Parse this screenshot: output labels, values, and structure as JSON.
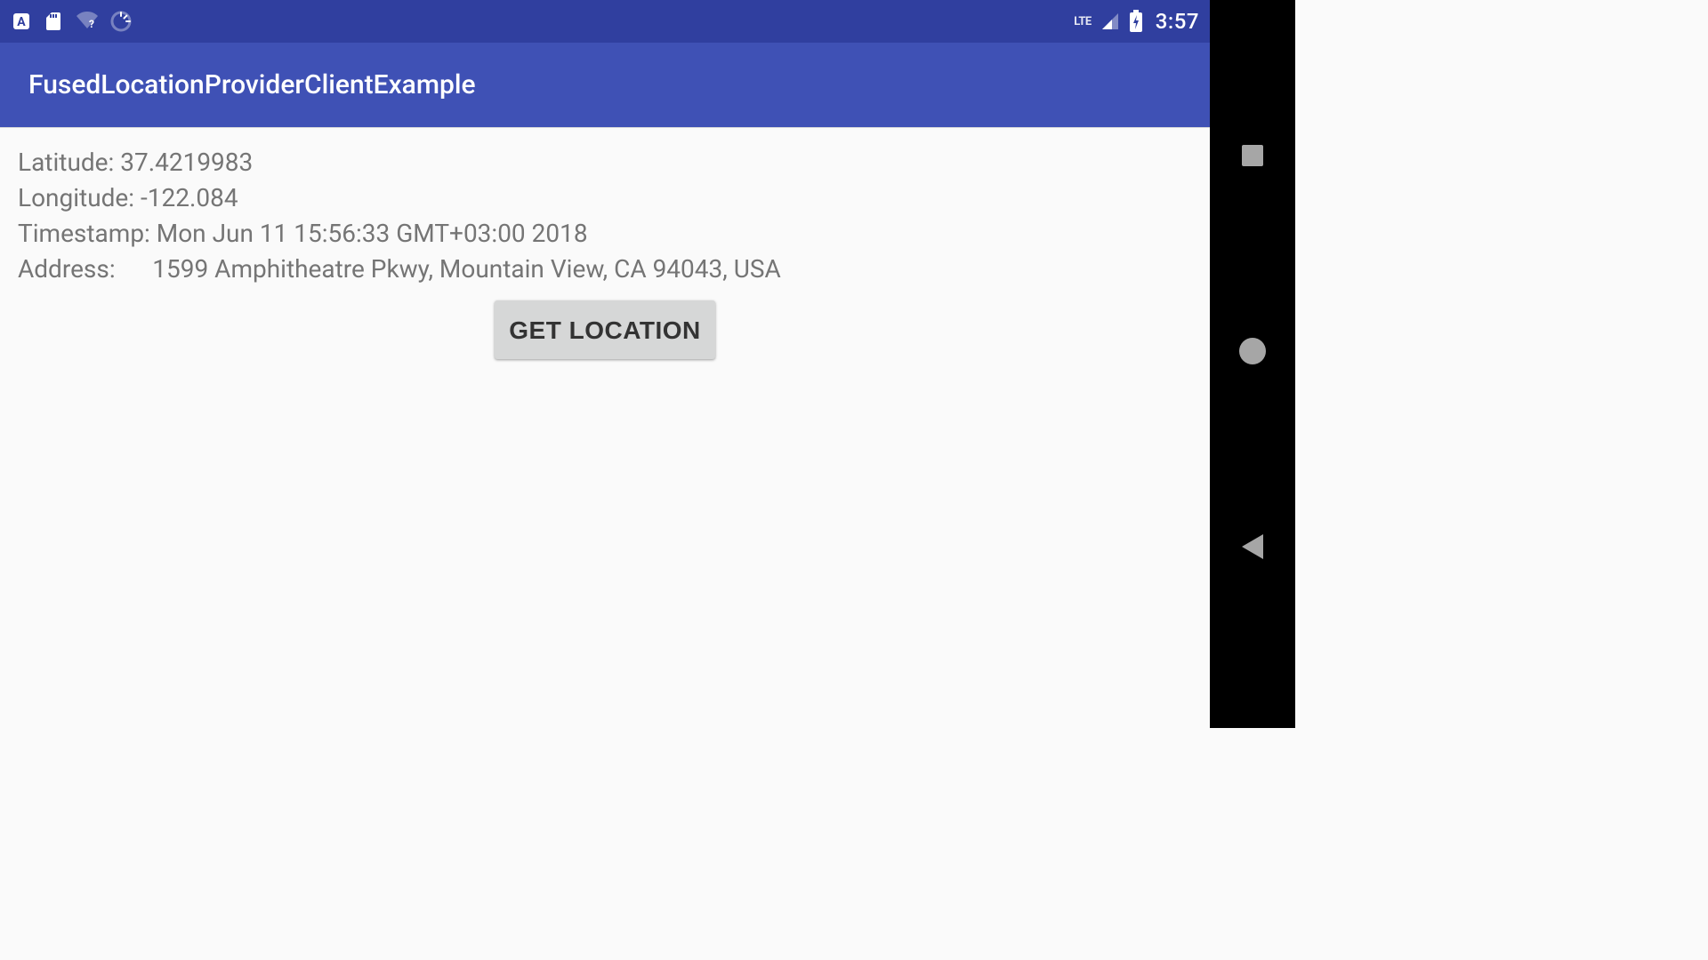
{
  "status_bar": {
    "clock": "3:57",
    "lte_label": "LTE"
  },
  "action_bar": {
    "title": "FusedLocationProviderClientExample"
  },
  "content": {
    "latitude": {
      "label": "Latitude: ",
      "value": "37.4219983"
    },
    "longitude": {
      "label": "Longitude: ",
      "value": "-122.084"
    },
    "timestamp": {
      "label": "Timestamp: ",
      "value": "Mon Jun 11 15:56:33 GMT+03:00 2018"
    },
    "address": {
      "label": "Address:      ",
      "value": "1599 Amphitheatre Pkwy, Mountain View, CA 94043, USA"
    },
    "button": "GET LOCATION"
  }
}
